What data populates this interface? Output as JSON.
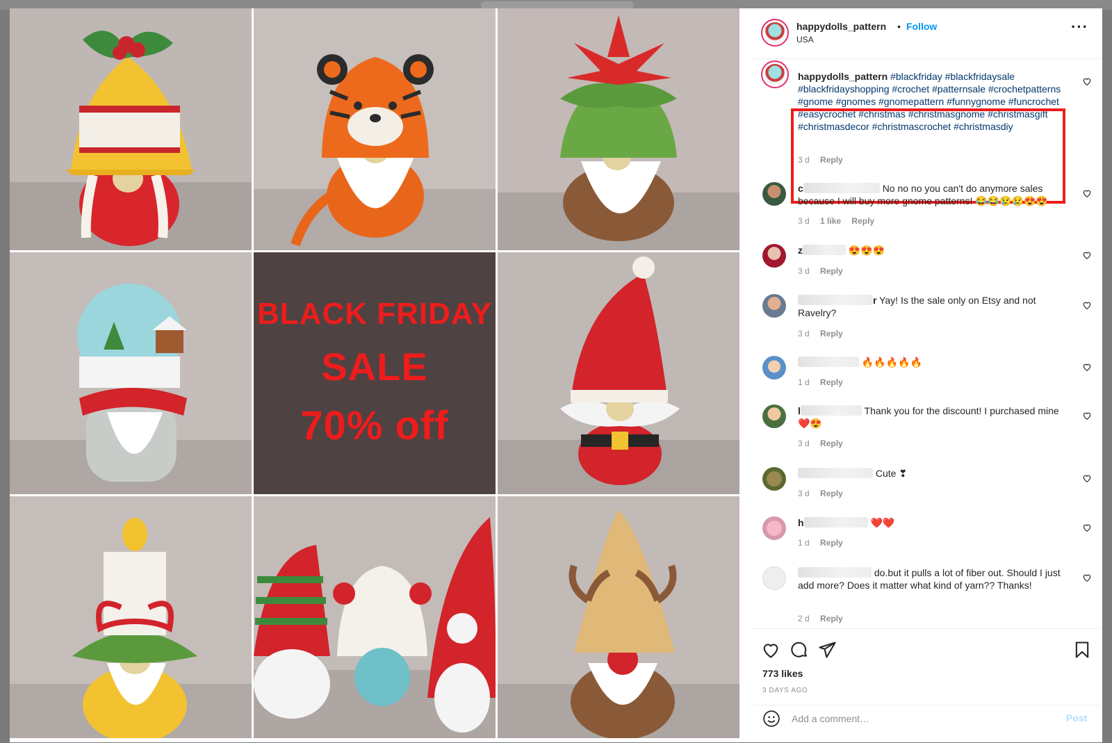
{
  "colors": {
    "accent": "#0095f6",
    "highlight": "#ee1c1c",
    "sale_bg": "#4f4242"
  },
  "post": {
    "username": "happydolls_pattern",
    "separator": "•",
    "follow_label": "Follow",
    "location": "USA",
    "more_icon": "more-options-icon"
  },
  "media": {
    "tiles": [
      {
        "subject": "crochet bell gnome"
      },
      {
        "subject": "crochet tiger gnome"
      },
      {
        "subject": "crochet poinsettia gnome"
      },
      {
        "subject": "crochet snow globe gnome"
      },
      {
        "subject": "sale banner"
      },
      {
        "subject": "crochet santa gnome"
      },
      {
        "subject": "crochet candle gnome"
      },
      {
        "subject": "three crochet gnomes"
      },
      {
        "subject": "crochet reindeer gnome"
      }
    ],
    "sale_banner": {
      "line1": "BLACK FRIDAY",
      "line2": "SALE",
      "line3": "70% off"
    }
  },
  "caption": {
    "username": "happydolls_pattern",
    "hashtags": "#blackfriday #blackfridaysale #blackfridayshopping #crochet #patternsale #crochetpatterns #gnome #gnomes #gnomepattern #funnygnome #funcrochet #easycrochet #christmas #christmasgnome #christmasgift #christmasdecor #christmascrochet #christmasdiy",
    "time": "3 d",
    "reply": "Reply"
  },
  "comments": [
    {
      "user_initial": "c",
      "text": "No no no you can't do anymore sales because I will buy more gnome patterns! 😂😂😢😢😍😍",
      "time": "3 d",
      "likes": "1 like",
      "reply": "Reply"
    },
    {
      "user_initial": "z",
      "text": "😍😍😍",
      "time": "3 d",
      "reply": "Reply"
    },
    {
      "user_initial": "r",
      "text": "Yay! Is the sale only on Etsy and not Ravelry?",
      "time": "3 d",
      "reply": "Reply"
    },
    {
      "user_initial": "",
      "text": "🔥🔥🔥🔥🔥",
      "time": "1 d",
      "reply": "Reply"
    },
    {
      "user_initial": "l",
      "text": "Thank you for the discount! I purchased mine ❤️😍",
      "time": "3 d",
      "reply": "Reply"
    },
    {
      "user_initial": "",
      "text": "Cute ❣",
      "time": "3 d",
      "reply": "Reply"
    },
    {
      "user_initial": "h",
      "text": "❤️❤️",
      "time": "1 d",
      "reply": "Reply"
    },
    {
      "user_initial": "",
      "text": "do.but it pulls a lot of fiber out. Should I just add more? Does it matter what kind of yarn?? Thanks!",
      "time": "2 d",
      "reply": "Reply"
    }
  ],
  "actions": {
    "likes": "773 likes",
    "time_ago": "3 DAYS AGO"
  },
  "add_comment": {
    "placeholder": "Add a comment…",
    "post_label": "Post"
  }
}
